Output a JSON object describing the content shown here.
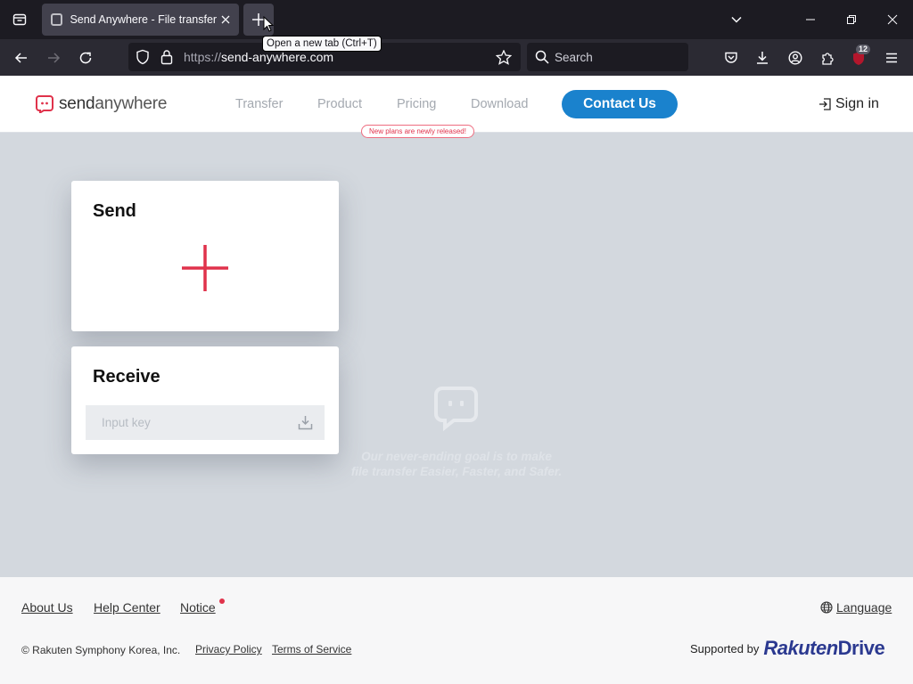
{
  "browser": {
    "tab_title": "Send Anywhere - File transfer",
    "tooltip": "Open a new tab (Ctrl+T)",
    "url_protocol": "https://",
    "url_host": "send-anywhere.com",
    "search_placeholder": "Search",
    "extension_badge": "12"
  },
  "header": {
    "logo_send": "send",
    "logo_anywhere": "anywhere",
    "menu": [
      "Transfer",
      "Product",
      "Pricing",
      "Download"
    ],
    "new_badge": "New plans are newly released!",
    "contact_label": "Contact Us",
    "signin_label": "Sign in"
  },
  "send": {
    "title": "Send"
  },
  "receive": {
    "title": "Receive",
    "input_placeholder": "Input key"
  },
  "hero": {
    "tagline_line1": "Our never-ending goal is to make",
    "tagline_line2": "file transfer Easier, Faster, and Safer."
  },
  "footer": {
    "links": [
      "About Us",
      "Help Center",
      "Notice"
    ],
    "language_label": "Language",
    "copyright": "© Rakuten Symphony Korea, Inc.",
    "privacy": "Privacy Policy",
    "terms": "Terms of Service",
    "supported_by": "Supported by",
    "brand_rakuten": "Rakuten",
    "brand_drive": "Drive"
  },
  "colors": {
    "accent_red": "#e0324b",
    "contact_blue": "#1a82cd",
    "page_bg": "#d3d8de"
  }
}
